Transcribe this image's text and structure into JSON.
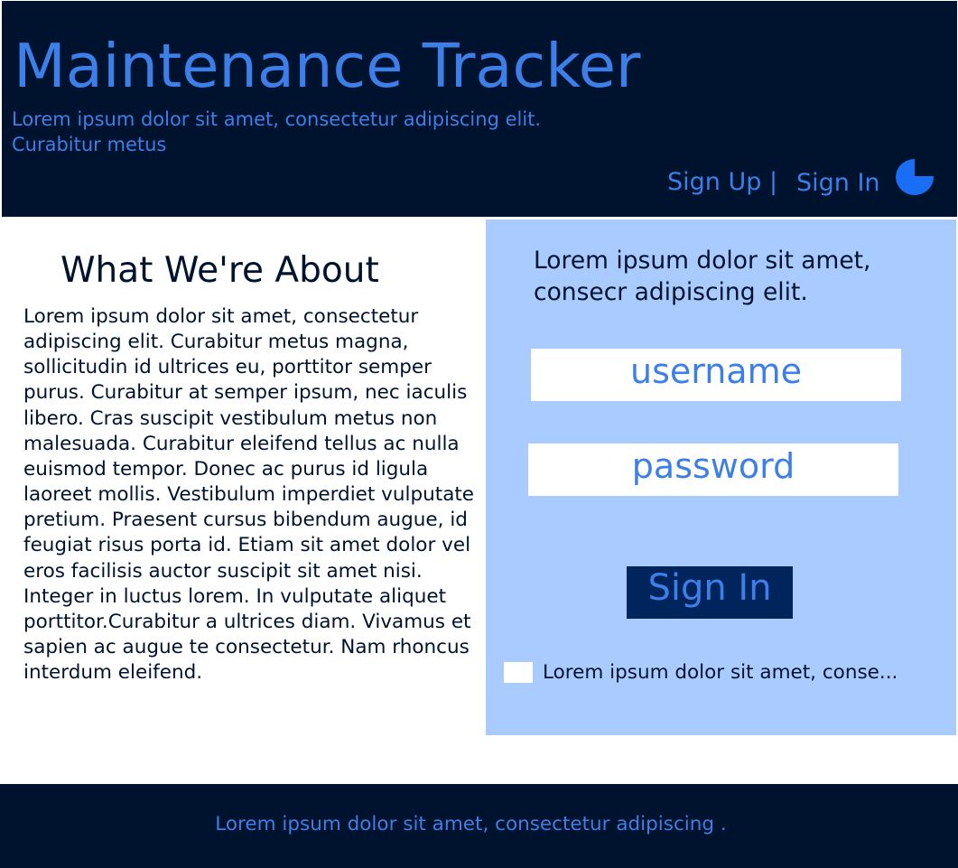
{
  "header": {
    "title": "Maintenance Tracker",
    "subtitle": "Lorem ipsum dolor sit amet, consectetur adipiscing elit. Curabitur metus",
    "nav": {
      "signup_label": "Sign Up |",
      "signin_label": "Sign In"
    },
    "logo_icon": "pie-logo-icon"
  },
  "about": {
    "heading": "What We're About",
    "body": "Lorem ipsum dolor sit amet, consectetur adipiscing elit. Curabitur metus magna, sollicitudin id ultrices eu, porttitor semper purus. Curabitur at semper ipsum, nec iaculis libero. Cras suscipit vestibulum metus non malesuada. Curabitur eleifend tellus ac nulla euismod tempor. Donec ac purus id ligula laoreet mollis. Vestibulum imperdiet vulputate pretium. Praesent cursus bibendum augue, id feugiat risus porta id. Etiam sit amet dolor vel eros facilisis auctor suscipit sit amet nisi. Integer in luctus lorem. In vulputate aliquet porttitor.Curabitur a ultrices diam. Vivamus et sapien ac augue te consectetur. Nam rhoncus interdum eleifend."
  },
  "login": {
    "intro": "Lorem ipsum dolor sit amet, consecr adipiscing elit.",
    "username_placeholder": "username",
    "password_placeholder": "password",
    "signin_button_label": "Sign In",
    "checkbox_label": "Lorem ipsum dolor sit amet, conse..."
  },
  "footer": {
    "text": "Lorem ipsum dolor sit amet, consectetur adipiscing ."
  },
  "colors": {
    "header_bg": "#00132e",
    "accent_text": "#3d7fe8",
    "panel_bg": "#a9cbff",
    "button_bg": "#00245c"
  }
}
